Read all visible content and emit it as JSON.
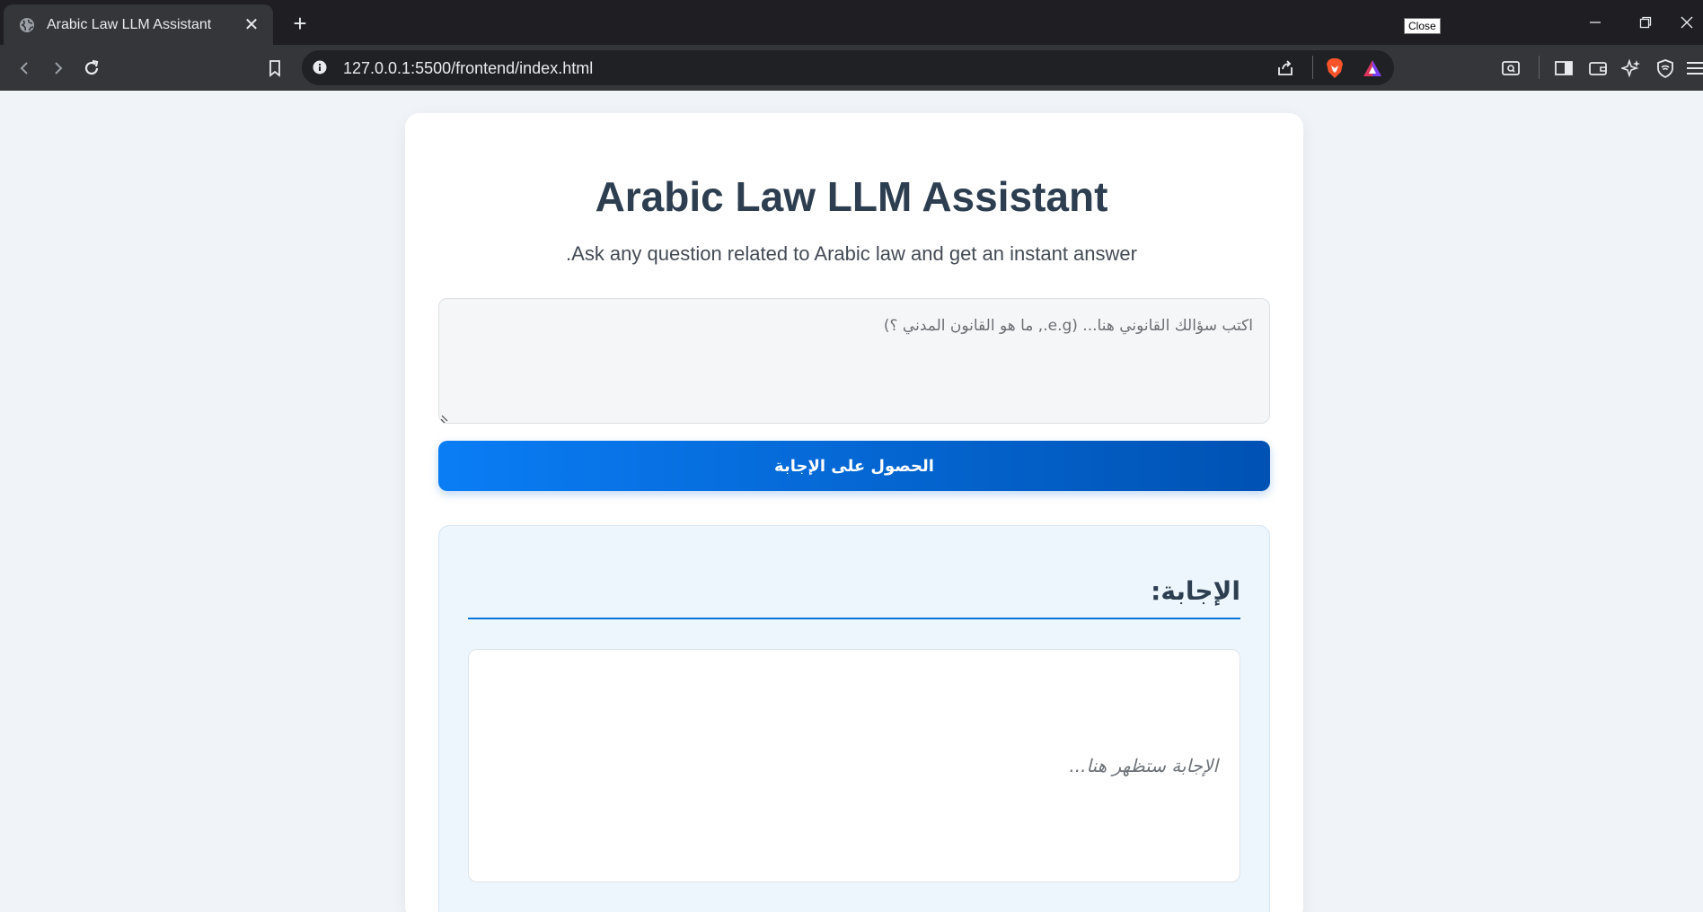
{
  "browser": {
    "tab_title": "Arabic Law LLM Assistant",
    "tab_close": "✕",
    "new_tab": "+",
    "tooltip": "Close",
    "url": "127.0.0.1:5500/frontend/index.html"
  },
  "page": {
    "title": "Arabic Law LLM Assistant",
    "subtitle": "Ask any question related to Arabic law and get an instant answer.",
    "question_placeholder": "اكتب سؤالك القانوني هنا... (e.g., ما هو القانون المدني ؟)",
    "submit_label": "الحصول على الإجابة",
    "answer_heading": "الإجابة:",
    "answer_placeholder": "الإجابة ستظهر هنا..."
  },
  "colors": {
    "chrome_dark": "#1f1f23",
    "chrome_toolbar": "#35363a",
    "page_bg": "#f0f3f7",
    "title": "#2c3e50",
    "button_start": "#0a7df5",
    "button_end": "#0052b3",
    "answer_bg": "#eef6fd",
    "rule": "#0a74d8"
  },
  "icons": {
    "tab_favicon": "globe-icon",
    "back": "back-arrow-icon",
    "forward": "forward-arrow-icon",
    "reload": "reload-icon",
    "bookmark": "bookmark-icon",
    "site_info": "info-icon",
    "share": "share-icon",
    "brave_shields": "brave-lion-icon",
    "brave_rewards": "brave-rewards-triangle-icon",
    "search_in_page": "search-page-icon",
    "sidebar": "sidebar-icon",
    "wallet": "wallet-icon",
    "leo_ai": "sparkle-icon",
    "vpn": "vpn-shield-icon",
    "menu": "hamburger-menu-icon"
  }
}
